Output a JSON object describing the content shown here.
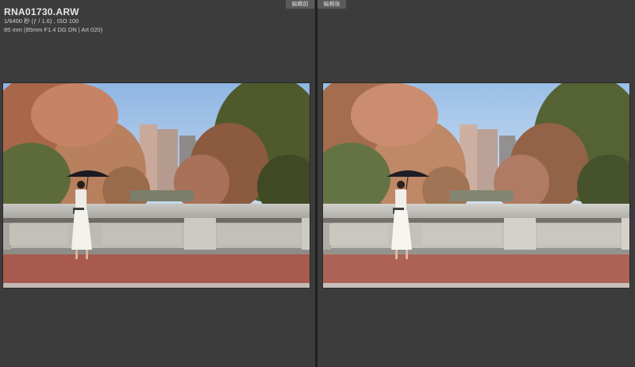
{
  "file": {
    "name": "RNA01730.ARW",
    "exposure": "1/6400 秒 (ƒ / 1.6) , ISO 100",
    "lens": "85 mm (85mm F1.4 DG DN | Art 020)"
  },
  "view_tabs": {
    "before": "編輯前",
    "after": "編輯後"
  },
  "colors": {
    "panel": "#3c3c3c",
    "divider": "#1f1f1f",
    "tab": "#5a5a5a"
  }
}
